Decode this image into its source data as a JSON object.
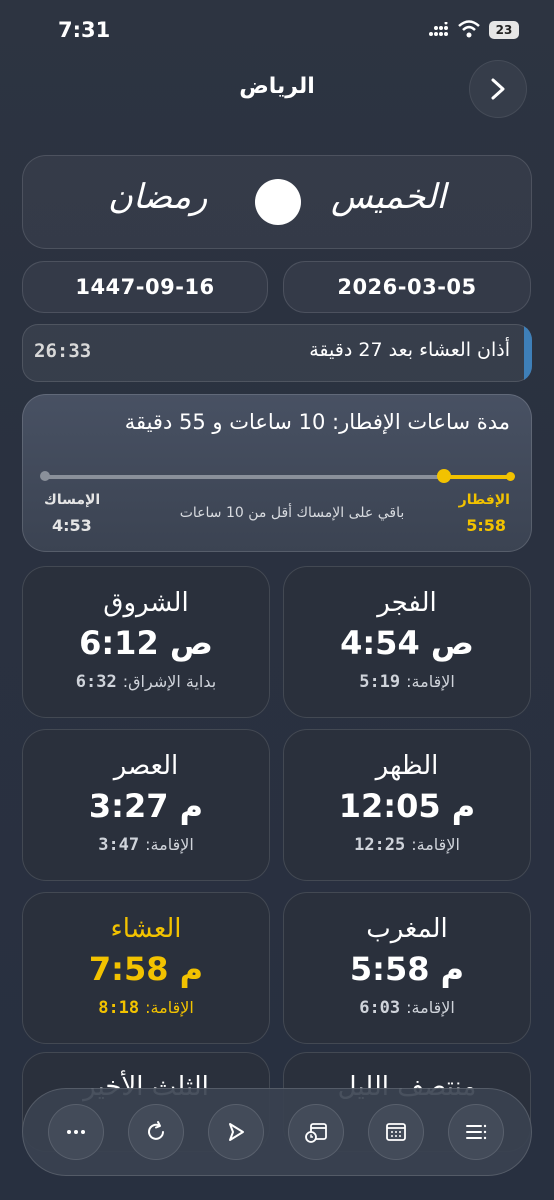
{
  "status_bar": {
    "time": "7:31",
    "battery": "23"
  },
  "header": {
    "title": "الرياض"
  },
  "hero": {
    "day_calligraphy": "الخميس",
    "month_calligraphy": "رمضان"
  },
  "dates": {
    "hijri": "1447-09-16",
    "gregorian": "2026-03-05"
  },
  "next_prayer": {
    "label": "أذان العشاء بعد 27 دقيقة",
    "countdown": "26:33",
    "accent": "#3e7fb8"
  },
  "fasting": {
    "title": "مدة ساعات الإفطار: 10 ساعات و 55 دقيقة",
    "iftar_label": "الإفطار",
    "iftar_time": "5:58",
    "imsak_label": "الإمساك",
    "imsak_time": "4:53",
    "remaining_text": "باقي على الإمساك أقل من 10 ساعات",
    "progress_fraction": 0.14,
    "accent": "#f2c200"
  },
  "prayers": [
    {
      "name": "الفجر",
      "time": "4:54 ص",
      "sub_label": "الإقامة:",
      "sub_time": "5:19"
    },
    {
      "name": "الشروق",
      "time": "6:12 ص",
      "sub_label": "بداية الإشراق:",
      "sub_time": "6:32"
    },
    {
      "name": "الظهر",
      "time": "12:05 م",
      "sub_label": "الإقامة:",
      "sub_time": "12:25"
    },
    {
      "name": "العصر",
      "time": "3:27 م",
      "sub_label": "الإقامة:",
      "sub_time": "3:47"
    },
    {
      "name": "المغرب",
      "time": "5:58 م",
      "sub_label": "الإقامة:",
      "sub_time": "6:03"
    },
    {
      "name": "العشاء",
      "time": "7:58 م",
      "sub_label": "الإقامة:",
      "sub_time": "8:18"
    }
  ],
  "partial_cards": {
    "right": "منتصف الليل",
    "left": "الثلث الأخير"
  },
  "dock": {
    "icons": [
      "menu-lines-icon",
      "calendar-icon",
      "calendar-clock-icon",
      "compass-icon",
      "refresh-icon",
      "more-icon"
    ]
  }
}
